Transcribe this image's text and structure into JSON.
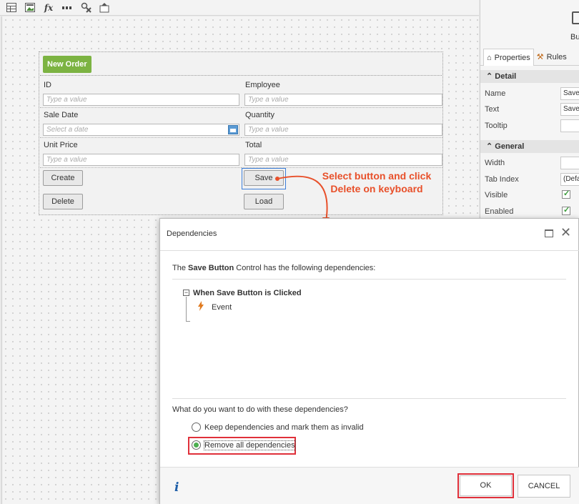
{
  "toolbar": {
    "icons": [
      "table-icon",
      "image-icon",
      "fx-icon",
      "dashed-line-icon",
      "settings-cross-icon",
      "hat-icon"
    ],
    "fx_label": "fx"
  },
  "form": {
    "new_order_label": "New Order",
    "fields": {
      "id_label": "ID",
      "id_placeholder": "Type a value",
      "employee_label": "Employee",
      "employee_placeholder": "Type a value",
      "sale_date_label": "Sale Date",
      "sale_date_placeholder": "Select a date",
      "quantity_label": "Quantity",
      "quantity_placeholder": "Type a value",
      "unit_price_label": "Unit Price",
      "unit_price_placeholder": "Type a value",
      "total_label": "Total",
      "total_placeholder": "Type a value"
    },
    "buttons": {
      "create": "Create",
      "save": "Save",
      "delete": "Delete",
      "load": "Load"
    }
  },
  "annotation": {
    "line1": "Select button and click",
    "line2": "Delete on keyboard",
    "color": "#e8502a"
  },
  "properties_panel": {
    "top_label": "Bu",
    "tabs": [
      "Properties",
      "Rules"
    ],
    "detail_section": "Detail",
    "general_section": "General",
    "rows": {
      "name_label": "Name",
      "name_value": "Save",
      "text_label": "Text",
      "text_value": "Save",
      "tooltip_label": "Tooltip",
      "width_label": "Width",
      "tab_index_label": "Tab Index",
      "tab_index_value": "(Defa",
      "visible_label": "Visible",
      "enabled_label": "Enabled"
    }
  },
  "dialog": {
    "title": "Dependencies",
    "desc_prefix": "The ",
    "desc_bold": "Save Button",
    "desc_suffix": " Control has the following dependencies:",
    "tree_node": "When Save Button is Clicked",
    "tree_child": "Event",
    "question": "What do you want to do with these dependencies?",
    "option_keep": "Keep dependencies and mark them as invalid",
    "option_remove": "Remove all dependencies",
    "selected_option": "Remove all dependencies",
    "ok": "OK",
    "cancel": "CANCEL",
    "highlight_color": "#e0303a"
  }
}
